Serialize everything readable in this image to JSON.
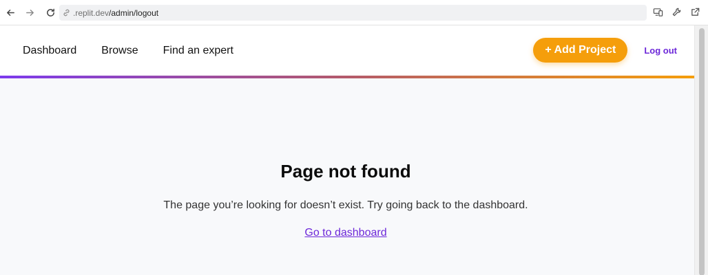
{
  "browser": {
    "url_host": ".replit.dev",
    "url_path": "/admin/logout",
    "icons": [
      "back-arrow-icon",
      "forward-arrow-icon",
      "reload-icon",
      "link-icon",
      "devices-icon",
      "wrench-icon",
      "open-external-icon"
    ]
  },
  "header": {
    "nav": [
      "Dashboard",
      "Browse",
      "Find an expert"
    ],
    "add_project_label": "+ Add Project",
    "logout_label": "Log out"
  },
  "main": {
    "title": "Page not found",
    "message": "The page you’re looking for doesn’t exist. Try going back to the dashboard.",
    "link_label": "Go to dashboard"
  },
  "colors": {
    "accent_orange": "#f59e0b",
    "accent_purple": "#6d28d9",
    "page_background": "#f8f9fb"
  }
}
